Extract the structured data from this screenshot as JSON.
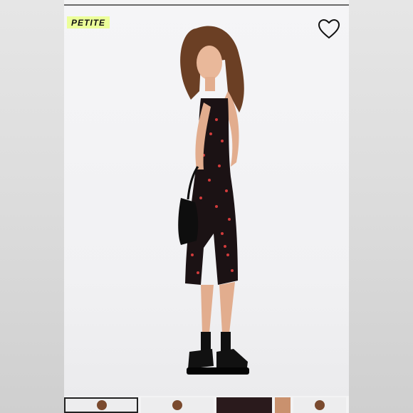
{
  "product": {
    "badge_label": "PETITE",
    "wishlist_icon": "heart-outline-icon"
  },
  "gallery": {
    "thumbnail_count": 5,
    "active_index": 0
  },
  "colors": {
    "badge_bg": "#ecff9a",
    "background": "#f3f3f4",
    "dress": "#1b1214",
    "dress_print": "#d23b3b"
  }
}
